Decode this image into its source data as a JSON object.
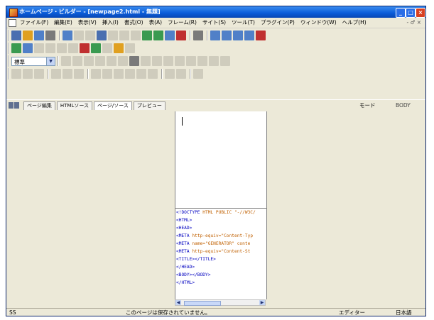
{
  "window": {
    "title": "ホームページ・ビルダー - [newpage2.html - 無題]",
    "buttons": {
      "minimize": "_",
      "maximize": "□",
      "close": "×"
    }
  },
  "menu": {
    "items": [
      "ファイル(F)",
      "編集(E)",
      "表示(V)",
      "挿入(I)",
      "書式(O)",
      "表(A)",
      "フレーム(R)",
      "サイト(S)",
      "ツール(T)",
      "プラグイン(P)",
      "ウィンドウ(W)",
      "ヘルプ(H)"
    ],
    "right": "- ♂ ×"
  },
  "toolbar": {
    "style_select": "標準"
  },
  "tabs": [
    "ページ編集",
    "HTMLソース",
    "ページ/ソース",
    "プレビュー"
  ],
  "mode": {
    "label": "モード",
    "value": "BODY"
  },
  "source": {
    "lines": [
      {
        "tag": "<!DOCTYPE",
        "rest": " HTML PUBLIC \"-//W3C/"
      },
      {
        "tag": "<HTML>",
        "rest": ""
      },
      {
        "tag": "<HEAD>",
        "rest": ""
      },
      {
        "tag": "<META",
        "rest": " http-equiv=\"Content-Typ"
      },
      {
        "tag": "<META",
        "rest": " name=\"GENERATOR\" conte"
      },
      {
        "tag": "<META",
        "rest": " http-equiv=\"Content-St"
      },
      {
        "tag": "<TITLE></TITLE>",
        "rest": ""
      },
      {
        "tag": "</HEAD>",
        "rest": ""
      },
      {
        "tag": "<BODY></BODY>",
        "rest": ""
      },
      {
        "tag": "</HTML>",
        "rest": ""
      }
    ]
  },
  "status": {
    "left": "SS",
    "message": "このページは保存されていません。",
    "editor": "エディター",
    "charset": "日本語"
  }
}
